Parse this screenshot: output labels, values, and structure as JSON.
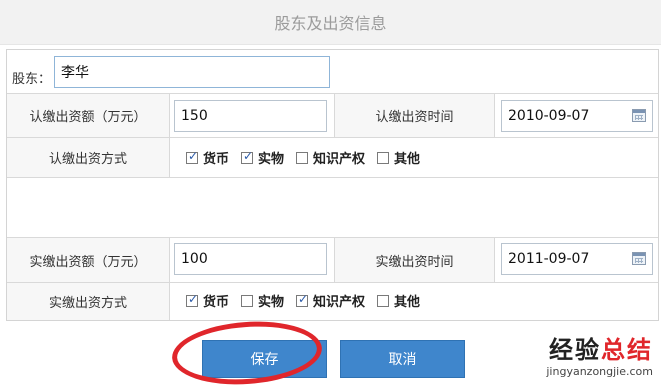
{
  "title": "股东及出资信息",
  "shareholder": {
    "label": "股东：",
    "value": "李华"
  },
  "subscribed": {
    "amount_label": "认缴出资额（万元）",
    "amount_value": "150",
    "time_label": "认缴出资时间",
    "time_value": "2010-09-07",
    "method_label": "认缴出资方式",
    "methods": [
      {
        "label": "货币",
        "checked": true
      },
      {
        "label": "实物",
        "checked": true
      },
      {
        "label": "知识产权",
        "checked": false
      },
      {
        "label": "其他",
        "checked": false
      }
    ]
  },
  "paid": {
    "amount_label": "实缴出资额（万元）",
    "amount_value": "100",
    "time_label": "实缴出资时间",
    "time_value": "2011-09-07",
    "method_label": "实缴出资方式",
    "methods": [
      {
        "label": "货币",
        "checked": true
      },
      {
        "label": "实物",
        "checked": false
      },
      {
        "label": "知识产权",
        "checked": true
      },
      {
        "label": "其他",
        "checked": false
      }
    ]
  },
  "buttons": {
    "save": "保存",
    "cancel": "取消"
  },
  "watermark": {
    "main_a": "经验",
    "main_b": "总结",
    "sub": "jingyanzongjie.com"
  },
  "colors": {
    "button": "#3f86cc",
    "highlight_ring": "#e0262b"
  }
}
